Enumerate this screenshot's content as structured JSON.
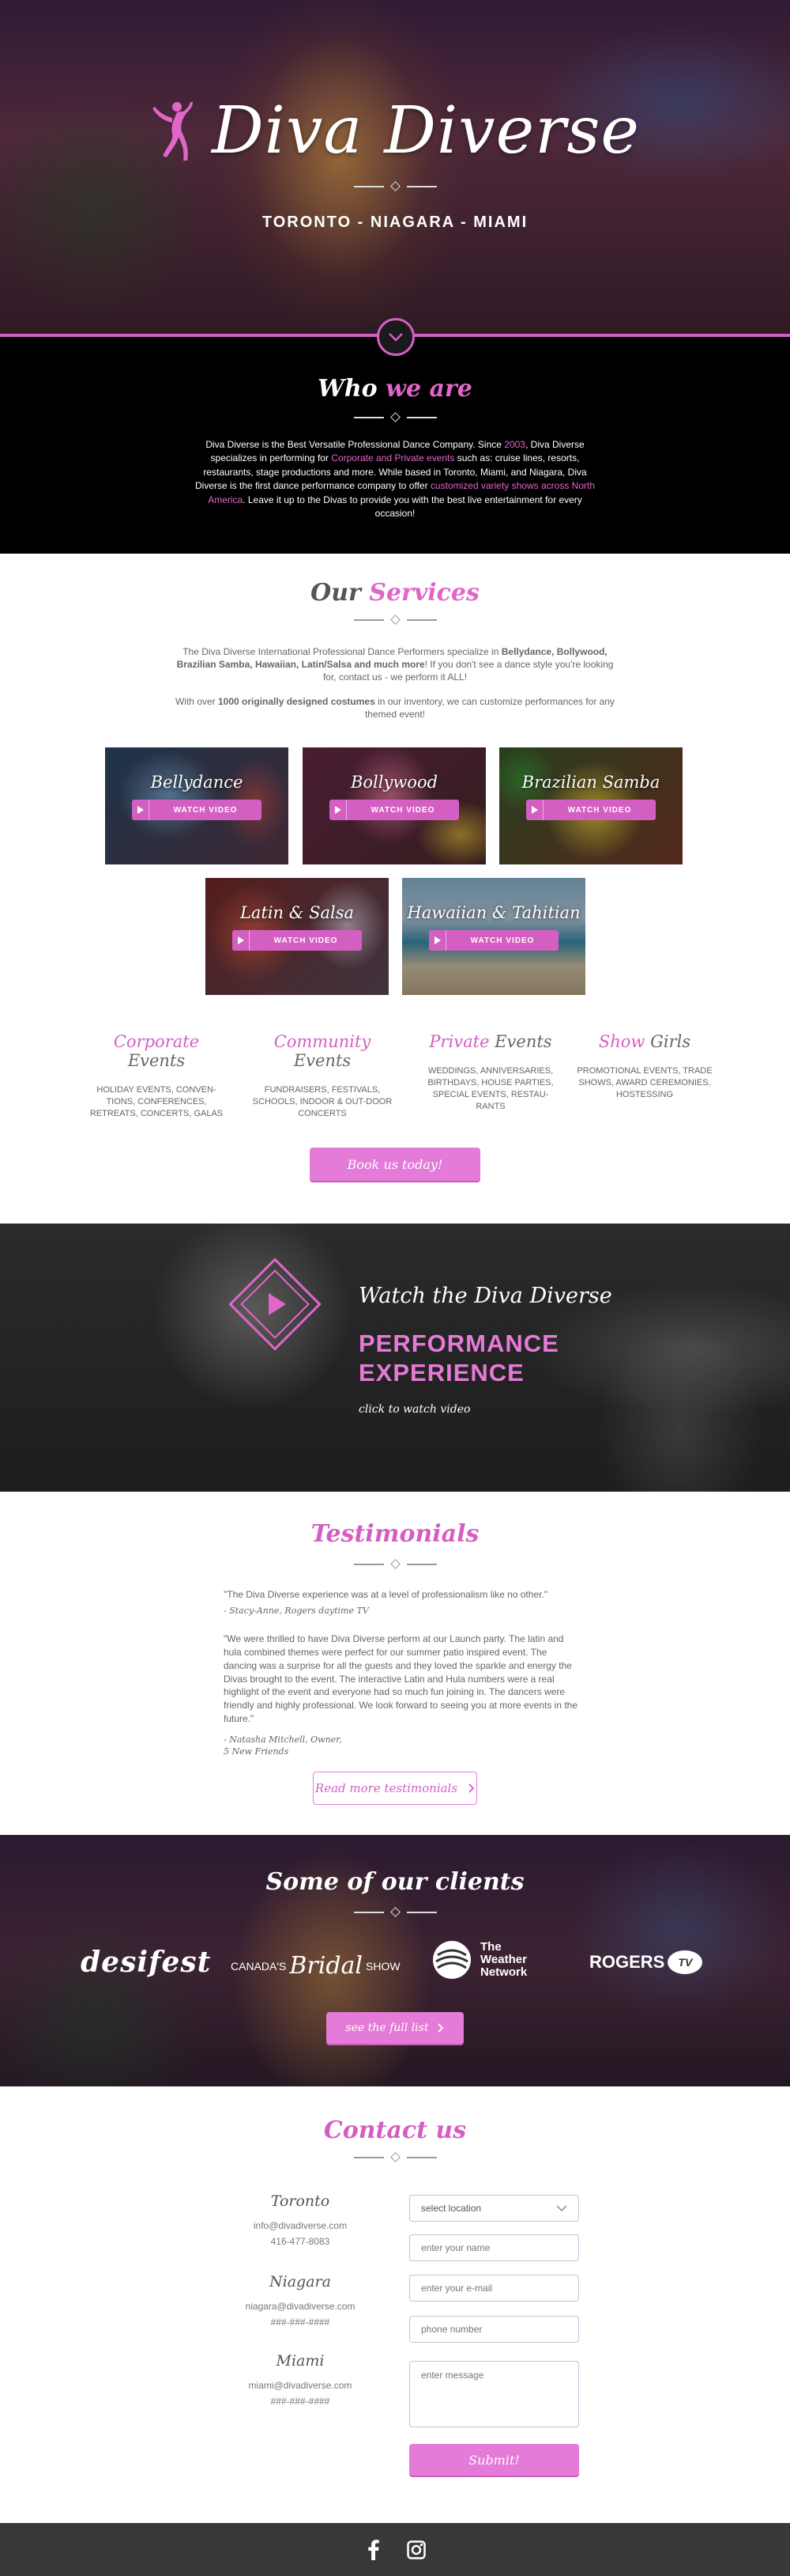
{
  "hero": {
    "title": "Diva Diverse",
    "cities": "TORONTO - NIAGARA - MIAMI"
  },
  "who": {
    "title_a": "Who ",
    "title_b": "we are",
    "p_a": "Diva Diverse is the Best Versatile  Professional Dance Company. Since ",
    "p_year": "2003",
    "p_b": ", Diva Diverse specializes in performing for ",
    "p_events": "Corporate and Private events",
    "p_c": " such as: cruise lines, resorts, restaurants, stage productions and more. While based in Toronto, Miami, and Niagara, Diva Diverse is the first dance performance company to offer ",
    "p_shows": "customized variety shows across North America",
    "p_d": ". Leave it up to the Divas to provide you with the best live  entertainment for every occasion!"
  },
  "services": {
    "title_a": "Our ",
    "title_b": "Services",
    "p1_a": "The Diva Diverse International Professional Dance Performers specialize in ",
    "p1_b": "Bellydance, Bollywood, Brazilian Samba, Hawaiian, Latin/Salsa and much more",
    "p1_c": "! If you don't see a dance style you're looking for, contact us - we perform it ALL!",
    "p2_a": "With over ",
    "p2_b": "1000 originally designed costumes",
    "p2_c": " in our inventory, we can customize performances for any themed event!",
    "watch_label": "WATCH VIDEO",
    "tiles": [
      {
        "label": "Bellydance"
      },
      {
        "label": "Bollywood"
      },
      {
        "label": "Brazilian Samba"
      },
      {
        "label": "Latin & Salsa"
      },
      {
        "label": "Hawaiian & Tahitian"
      }
    ],
    "events": [
      {
        "hl": "Corporate",
        "rest": " Events",
        "desc": "HOLIDAY EVENTS, CONVEN-TIONS, CONFERENCES, RETREATS, CONCERTS, GALAS"
      },
      {
        "hl": "Community",
        "rest": " Events",
        "desc": "FUNDRAISERS, FESTIVALS, SCHOOLS, INDOOR & OUT-DOOR CONCERTS"
      },
      {
        "hl": "Private",
        "rest": " Events",
        "desc": "WEDDINGS, ANNIVERSARIES, BIRTHDAYS, HOUSE PARTIES, SPECIAL EVENTS, RESTAU-RANTS"
      },
      {
        "hl": "Show",
        "rest": " Girls",
        "desc": "PROMOTIONAL EVENTS, TRADE SHOWS, AWARD CEREMONIES, HOSTESSING"
      }
    ],
    "book_label": "Book us today!"
  },
  "performance": {
    "sub": "Watch the Diva Diverse",
    "big1": "PERFORMANCE",
    "big2": "EXPERIENCE",
    "click": "click to watch video"
  },
  "testimonials": {
    "title": "Testimonials",
    "q1": "\"The Diva Diverse experience was at a level of professionalism like no other.\"",
    "a1": "- Stacy-Anne, Rogers daytime TV",
    "q2": "\"We were thrilled to have Diva Diverse perform at our Launch party. The latin and hula combined themes were perfect for our summer patio inspired event. The dancing was a surprise for all the guests and they loved the sparkle and energy the Divas brought to the event. The interactive Latin and Hula numbers were a real highlight of the event and everyone had so much fun joining in. The dancers were friendly and highly professional. We look forward to seeing you at more events in the future.\"",
    "a2a": "- Natasha Mitchell, Owner,",
    "a2b": "5 New Friends",
    "more_label": "Read more testimonials"
  },
  "clients": {
    "title": "Some of our clients",
    "desi": "desifest",
    "bridal_a": "CANADA'S",
    "bridal_b": "Bridal",
    "bridal_c": "SHOW",
    "weather_a": "The",
    "weather_b": "Weather",
    "weather_c": "Network",
    "rogers": "ROGERS",
    "rogers_tv": "TV",
    "full_label": "see the full list"
  },
  "contact": {
    "title": "Contact us",
    "offices": [
      {
        "name": "Toronto",
        "email": "info@divadiverse.com",
        "phone": "416-477-8083"
      },
      {
        "name": "Niagara",
        "email": "niagara@divadiverse.com",
        "phone": "###-###-####"
      },
      {
        "name": "Miami",
        "email": "miami@divadiverse.com",
        "phone": "###-###-####"
      }
    ],
    "select_label": "select location",
    "name_ph": "enter your name",
    "email_ph": "enter your e-mail",
    "phone_ph": "phone number",
    "message_ph": "enter message",
    "submit_label": "Submit!"
  },
  "colors": {
    "accent": "#d45fc2",
    "button": "#e47bd8",
    "dark": "#000000",
    "footer": "#383838"
  },
  "icons": [
    "dancer-logo-icon",
    "chevron-down-icon",
    "play-icon",
    "diamond-play-icon",
    "chevron-right-icon",
    "weather-globe-icon",
    "facebook-icon",
    "instagram-icon"
  ]
}
